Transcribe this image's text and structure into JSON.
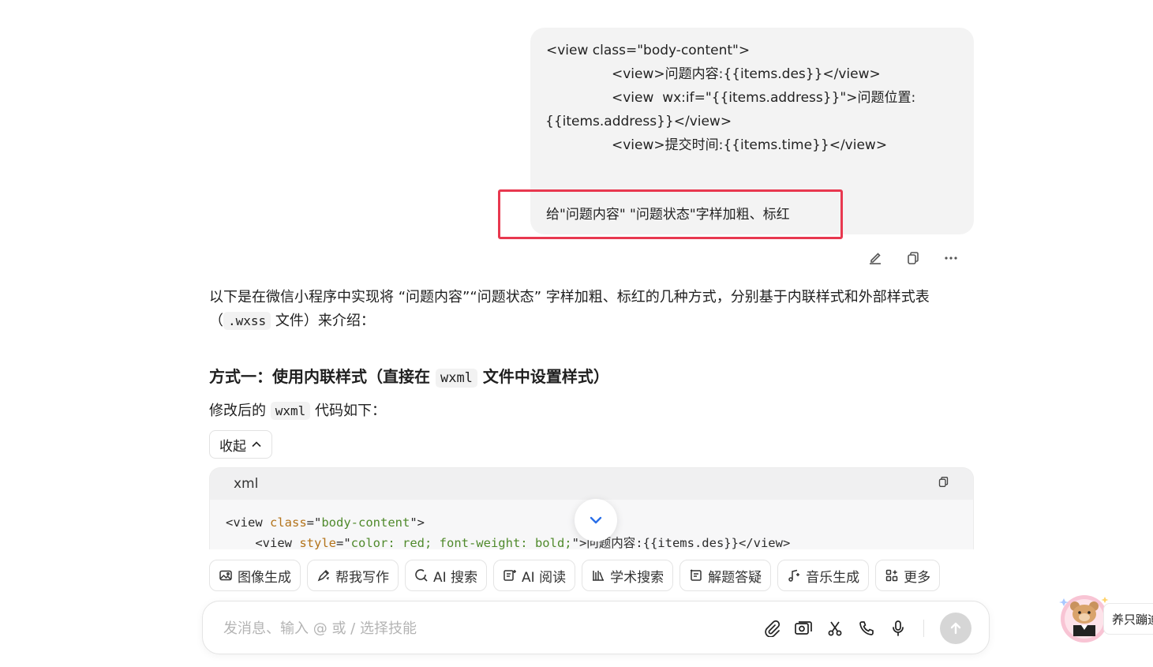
{
  "user_message": {
    "code_lines": [
      "<view class=\"body-content\">",
      "<view>问题内容:{{items.des}}</view>",
      "<view  wx:if=\"{{items.address}}\">问题位置:",
      "{{items.address}}</view>",
      "<view>提交时间:{{items.time}}</view>"
    ],
    "request": "给\"问题内容\" \"问题状态\"字样加粗、标红"
  },
  "message_actions": {
    "edit": "edit-icon",
    "copy": "copy-icon",
    "more": "more-icon"
  },
  "answer": {
    "intro_before": "以下是在微信小程序中实现将 “问题内容”“问题状态” 字样加粗、标红的几种方式，分别基于内联样式和外部样式表（",
    "intro_code": ".wxss",
    "intro_after": " 文件）来介绍：",
    "heading_before": "方式一：使用内联样式（直接在 ",
    "heading_code": "wxml",
    "heading_after": " 文件中设置样式）",
    "sub_before": "修改后的 ",
    "sub_code": "wxml",
    "sub_after": " 代码如下："
  },
  "collapse_label": "收起",
  "code_block": {
    "language": "xml",
    "line1": {
      "open": "<view ",
      "attr": "class",
      "eq": "=\"",
      "val": "body-content",
      "close": "\">"
    },
    "line2": {
      "open": "    <view ",
      "attr": "style",
      "eq": "=\"",
      "val": "color: red; font-weight: bold;",
      "close": "\">问题内容:{{items.des}}</view>"
    }
  },
  "skills": [
    {
      "label": "图像生成",
      "icon": "image-icon"
    },
    {
      "label": "帮我写作",
      "icon": "pen-icon"
    },
    {
      "label": "AI 搜索",
      "icon": "search-icon"
    },
    {
      "label": "AI 阅读",
      "icon": "read-icon"
    },
    {
      "label": "学术搜索",
      "icon": "academic-icon"
    },
    {
      "label": "解题答疑",
      "icon": "solve-icon"
    },
    {
      "label": "音乐生成",
      "icon": "music-icon"
    },
    {
      "label": "更多",
      "icon": "grid-icon"
    }
  ],
  "composer": {
    "placeholder": "发消息、输入 @ 或 / 选择技能",
    "value": ""
  },
  "mascot_label": "养只蹦迪"
}
